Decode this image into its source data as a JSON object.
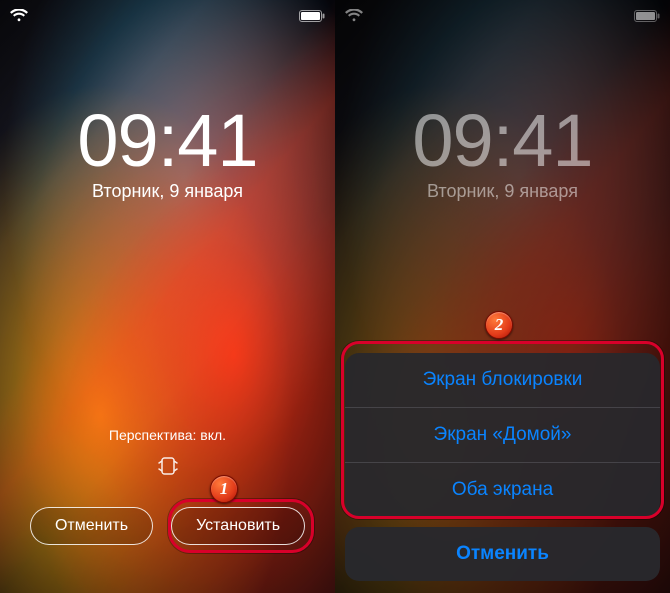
{
  "left": {
    "time": "09:41",
    "date": "Вторник, 9 января",
    "perspective_label": "Перспектива: вкл.",
    "cancel_label": "Отменить",
    "set_label": "Установить"
  },
  "right": {
    "time": "09:41",
    "date": "Вторник, 9 января",
    "sheet": {
      "option_lock": "Экран блокировки",
      "option_home": "Экран «Домой»",
      "option_both": "Оба экрана",
      "cancel": "Отменить"
    }
  },
  "annotations": {
    "badge1": "1",
    "badge2": "2"
  },
  "colors": {
    "highlight": "#d8002a",
    "ios_blue": "#0a84ff"
  }
}
